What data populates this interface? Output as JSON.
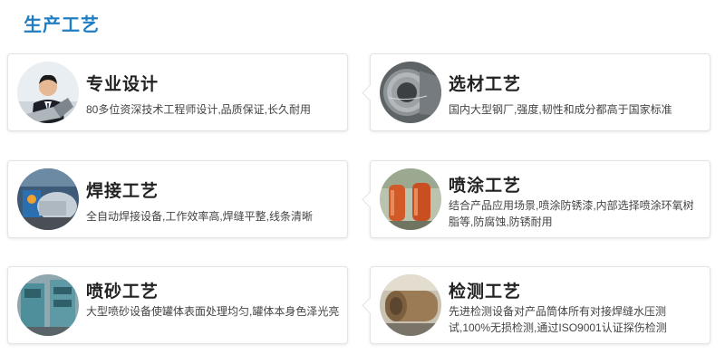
{
  "section": {
    "title": "生产工艺"
  },
  "cards": [
    {
      "title": "专业设计",
      "desc": "80多位资深技术工程师设计,品质保证,长久耐用",
      "icon": "engineer-laptop-icon"
    },
    {
      "title": "选材工艺",
      "desc": "国内大型钢厂,强度,韧性和成分都高于国家标准",
      "icon": "steel-coil-icon"
    },
    {
      "title": "焊接工艺",
      "desc": "全自动焊接设备,工作效率高,焊缝平整,线条清晰",
      "icon": "welding-machine-icon"
    },
    {
      "title": "喷涂工艺",
      "desc": "结合产品应用场景,喷涂防锈漆,内部选择喷涂环氧树脂等,防腐蚀,防锈耐用",
      "icon": "painted-tanks-icon"
    },
    {
      "title": "喷砂工艺",
      "desc": "大型喷砂设备使罐体表面处理均匀,罐体本身色泽光亮",
      "icon": "sandblasting-equipment-icon"
    },
    {
      "title": "检测工艺",
      "desc": "先进检测设备对产品筒体所有对接焊缝水压测试,100%无损检测,通过ISO9001认证探伤检测",
      "icon": "inspection-tank-icon"
    }
  ]
}
